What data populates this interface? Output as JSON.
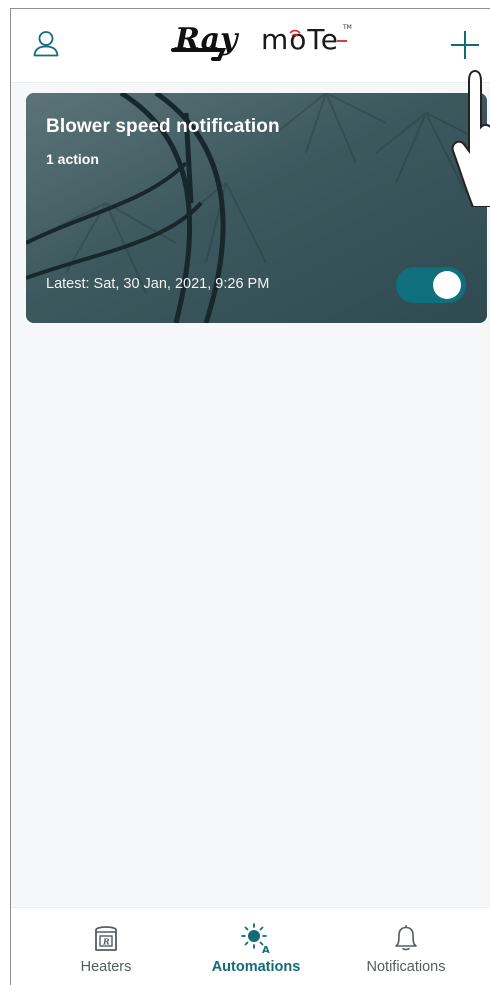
{
  "header": {
    "logo_text_left": "Ray",
    "logo_text_right": "moTe",
    "logo_tm": "TM"
  },
  "automations": [
    {
      "title": "Blower speed notification",
      "subtitle": "1 action",
      "latest": "Latest: Sat, 30 Jan, 2021, 9:26 PM",
      "enabled": true
    }
  ],
  "bottom_nav": {
    "items": [
      {
        "label": "Heaters",
        "icon": "heater-icon",
        "active": false
      },
      {
        "label": "Automations",
        "icon": "automation-sun-icon",
        "active": true
      },
      {
        "label": "Notifications",
        "icon": "bell-icon",
        "active": false
      }
    ]
  },
  "colors": {
    "accent": "#136b79",
    "toggle_on": "#0f6f7c",
    "logo_red": "#d4262f"
  }
}
